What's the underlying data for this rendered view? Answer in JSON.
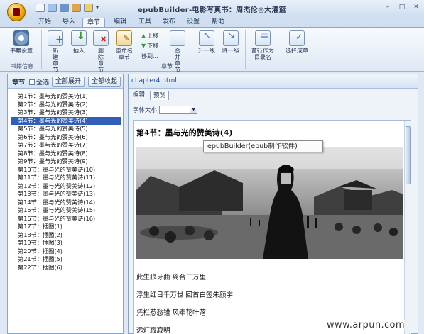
{
  "app": {
    "title": "epubBuilder-电影写真书：周杰伦◎大灌篮",
    "window_buttons": [
      "minimize-icon",
      "restore-icon",
      "close-icon"
    ]
  },
  "quick_access_icons": [
    "new-icon",
    "open-icon",
    "save-icon",
    "export-icon",
    "folder-icon",
    "customize-icon"
  ],
  "menu_tabs": [
    {
      "label": "开始",
      "active": false
    },
    {
      "label": "导入",
      "active": false
    },
    {
      "label": "章节",
      "active": true
    },
    {
      "label": "编辑",
      "active": false
    },
    {
      "label": "工具",
      "active": false
    },
    {
      "label": "发布",
      "active": false
    },
    {
      "label": "设置",
      "active": false
    },
    {
      "label": "帮助",
      "active": false
    }
  ],
  "ribbon": {
    "book_settings": "书籍设置",
    "book_info_group": "书籍信息",
    "new_chapter": "新建章节",
    "insert": "插入",
    "delete_chapter": "删除章节",
    "rename": "重命名章节",
    "move_up": "上移",
    "move_down": "下移",
    "move_to": "移到...",
    "merge_chapter": "合并章节",
    "chapter_group": "章节",
    "promote": "升一级",
    "demote": "降一级",
    "first_as_toc": "首行作为目录名",
    "select_as_chapter": "选择成章"
  },
  "sidebar": {
    "title": "章节",
    "select_all": "全选",
    "expand_all": "全部展开",
    "collapse_all": "全部收起",
    "items": [
      "第1节：墨与光的赞美诗(1)",
      "第2节：墨与光的赞美诗(2)",
      "第3节：墨与光的赞美诗(3)",
      "第4节：墨与光的赞美诗(4)",
      "第5节：墨与光的赞美诗(5)",
      "第6节：墨与光的赞美诗(6)",
      "第7节：墨与光的赞美诗(7)",
      "第8节：墨与光的赞美诗(8)",
      "第9节：墨与光的赞美诗(9)",
      "第10节：墨与光的赞美诗(10)",
      "第11节：墨与光的赞美诗(11)",
      "第12节：墨与光的赞美诗(12)",
      "第13节：墨与光的赞美诗(13)",
      "第14节：墨与光的赞美诗(14)",
      "第15节：墨与光的赞美诗(15)",
      "第16节：墨与光的赞美诗(16)",
      "第17节：插图(1)",
      "第18节：插图(2)",
      "第19节：插图(3)",
      "第20节：插图(4)",
      "第21节：插图(5)",
      "第22节：插图(6)"
    ],
    "selected_index": 3
  },
  "editor": {
    "file_name": "chapter4.html",
    "tabs": [
      "编辑",
      "预览"
    ],
    "active_tab": "预览",
    "font_size_label": "字体大小",
    "font_size_value": "",
    "chapter_title": "第4节：墨与光的赞美诗(4)",
    "poem_lines": [
      "此生狼牙曲  离合三万里",
      "浮生红日千万世  回首白签朱颜字",
      "凭栏惹愁错  风牵花叶落",
      "远灯寂寂明"
    ]
  },
  "tooltip": "epubBuilder(epub制作软件)",
  "watermark": "www.arpun.com"
}
